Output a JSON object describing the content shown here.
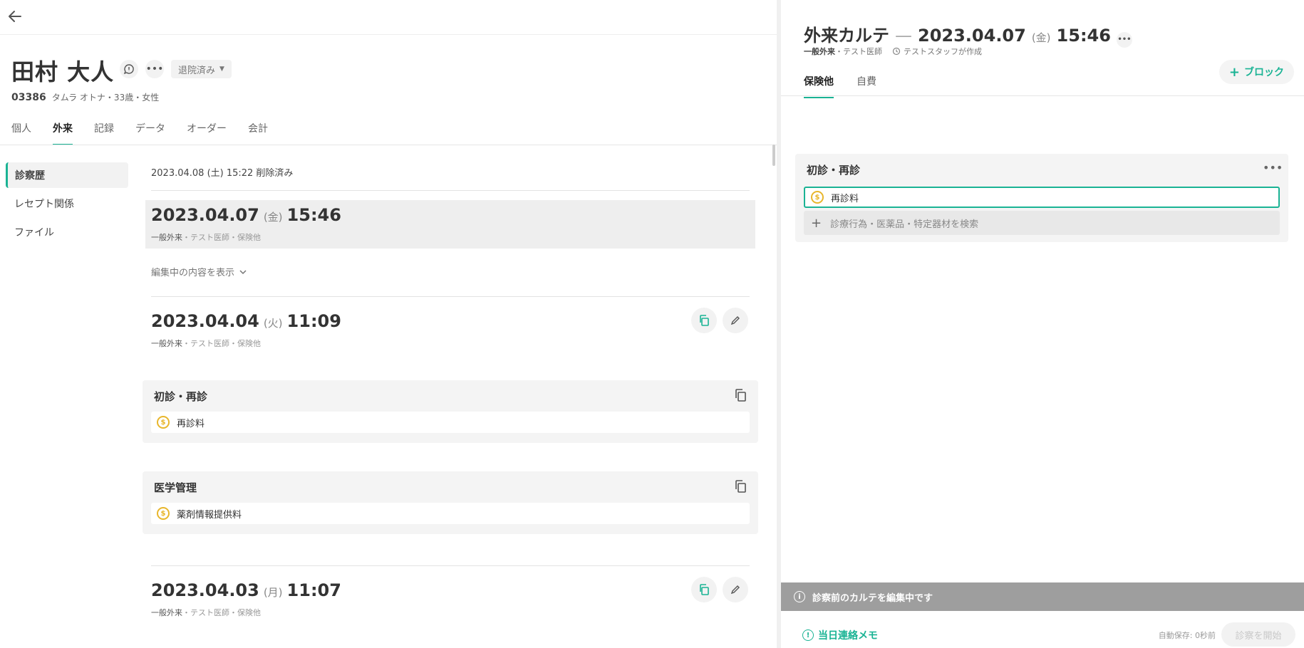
{
  "patient": {
    "name": "田村 大人",
    "status": "退院済み",
    "id": "03386",
    "info": "タムラ オトナ・33歳・女性"
  },
  "main_tabs": [
    {
      "label": "個人"
    },
    {
      "label": "外来"
    },
    {
      "label": "記録"
    },
    {
      "label": "データ"
    },
    {
      "label": "オーダー"
    },
    {
      "label": "会計"
    }
  ],
  "subnav": [
    {
      "label": "診察歴"
    },
    {
      "label": "レセプト関係"
    },
    {
      "label": "ファイル"
    }
  ],
  "history": {
    "deleted_row": "2023.04.08 (土) 15:22 削除済み",
    "show_editing": "編集中の内容を表示",
    "visits": [
      {
        "date": "2023.04.07",
        "dow": "(金)",
        "time": "15:46",
        "meta_type": "一般外来",
        "meta_rest": "・テスト医師・保険他"
      },
      {
        "date": "2023.04.04",
        "dow": "(火)",
        "time": "11:09",
        "meta_type": "一般外来",
        "meta_rest": "・テスト医師・保険他"
      },
      {
        "date": "2023.04.03",
        "dow": "(月)",
        "time": "11:07",
        "meta_type": "一般外来",
        "meta_rest": "・テスト医師・保険他"
      }
    ],
    "blocks": [
      {
        "title": "初診・再診",
        "item": "再診料"
      },
      {
        "title": "医学管理",
        "item": "薬剤情報提供料"
      }
    ]
  },
  "karte": {
    "title": "外来カルテ",
    "dash": "—",
    "date": "2023.04.07",
    "dow": "(金)",
    "time": "15:46",
    "meta_type": "一般外来",
    "meta_doctor": "・テスト医師",
    "meta_creator": "テストスタッフが作成",
    "tabs": [
      {
        "label": "保険他"
      },
      {
        "label": "自費"
      }
    ],
    "add_block": "ブロック",
    "block": {
      "title": "初診・再診",
      "item": "再診料",
      "search_placeholder": "診療行為・医薬品・特定器材を検索"
    },
    "banner": "診察前のカルテを編集中です",
    "memo": "当日連絡メモ",
    "autosave": "自動保存: 0秒前",
    "start_button": "診察を開始"
  },
  "colors": {
    "accent": "#1ab394",
    "coin": "#e8b62c",
    "banner": "#9e9e9e"
  }
}
